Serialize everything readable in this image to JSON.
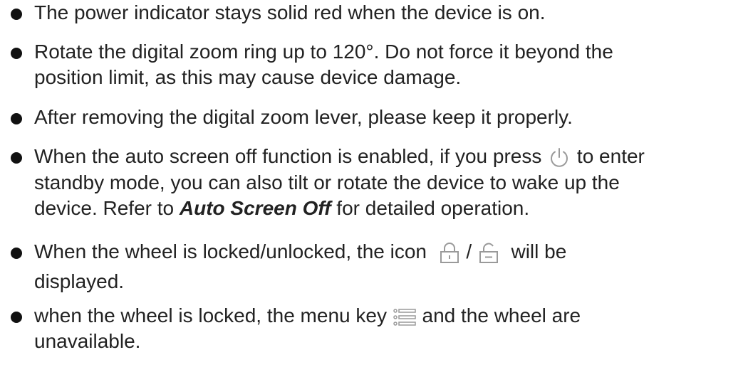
{
  "notes": [
    {
      "line1": "The power indicator stays solid red when the device is on."
    },
    {
      "line1": "Rotate the digital zoom ring up to 120°. Do not force it beyond the",
      "line2": "position limit, as this may cause device damage."
    },
    {
      "line1": "After removing the digital zoom lever, please keep it properly."
    },
    {
      "line1_before": "When the auto screen off function is enabled, if you press",
      "line1_after": "to enter",
      "line2": "standby mode, you can also tilt or rotate the device to wake up the",
      "line3_before": "device. Refer to",
      "line3_ref": "Auto Screen Off",
      "line3_after": "for detailed operation."
    },
    {
      "line1_before": "When the wheel is locked/unlocked, the icon",
      "line1_sep": "/",
      "line1_after": "will be",
      "line2": "displayed."
    },
    {
      "line1_before": "when the wheel is locked, the menu key",
      "line1_after": "and the wheel are",
      "line2": "unavailable."
    }
  ],
  "icons": {
    "power": "power-icon",
    "lock": "lock-icon",
    "unlock": "unlock-icon",
    "menu": "menu-icon",
    "icon_color": "#9a9a9a",
    "bullet_color": "#111111"
  }
}
